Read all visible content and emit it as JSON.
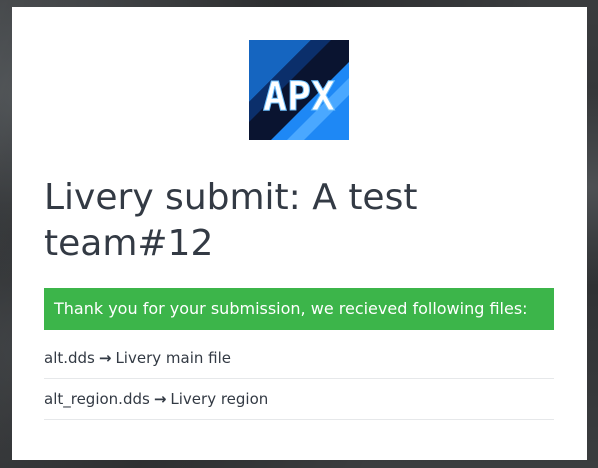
{
  "page": {
    "title": "Livery submit: A test team#12"
  },
  "logo": {
    "text": "APX",
    "colors": {
      "dark": "#0a1430",
      "blue": "#1e88f5",
      "light": "#6fc2ff"
    }
  },
  "alert": {
    "text": "Thank you for your submission, we recieved following files:",
    "color": "#3cb54a"
  },
  "files": [
    {
      "filename": "alt.dds",
      "arrow": "→",
      "description": "Livery main file"
    },
    {
      "filename": "alt_region.dds",
      "arrow": "→",
      "description": "Livery region"
    }
  ]
}
